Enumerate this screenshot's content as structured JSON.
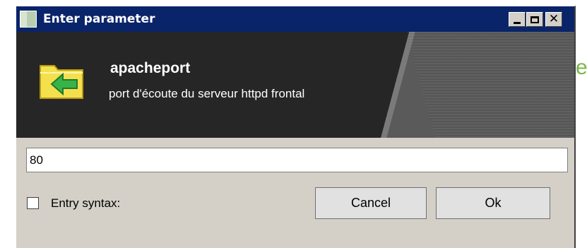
{
  "background_fragment": "e",
  "window": {
    "title": "Enter parameter",
    "controls": {
      "minimize": "minimize",
      "maximize": "maximize",
      "close": "✕"
    }
  },
  "banner": {
    "icon": "folder-import-icon",
    "parameter_name": "apacheport",
    "parameter_description": "port d'écoute du serveur httpd frontal"
  },
  "input": {
    "value": "80"
  },
  "entry_syntax": {
    "label": "Entry syntax:",
    "checked": false
  },
  "buttons": {
    "cancel": "Cancel",
    "ok": "Ok"
  },
  "colors": {
    "titlebar": "#0a246a",
    "banner": "#262626",
    "dialog_face": "#d4d0c8",
    "icon_folder": "#f4e04d",
    "icon_arrow": "#37b34a",
    "background_text": "#7ab648"
  }
}
